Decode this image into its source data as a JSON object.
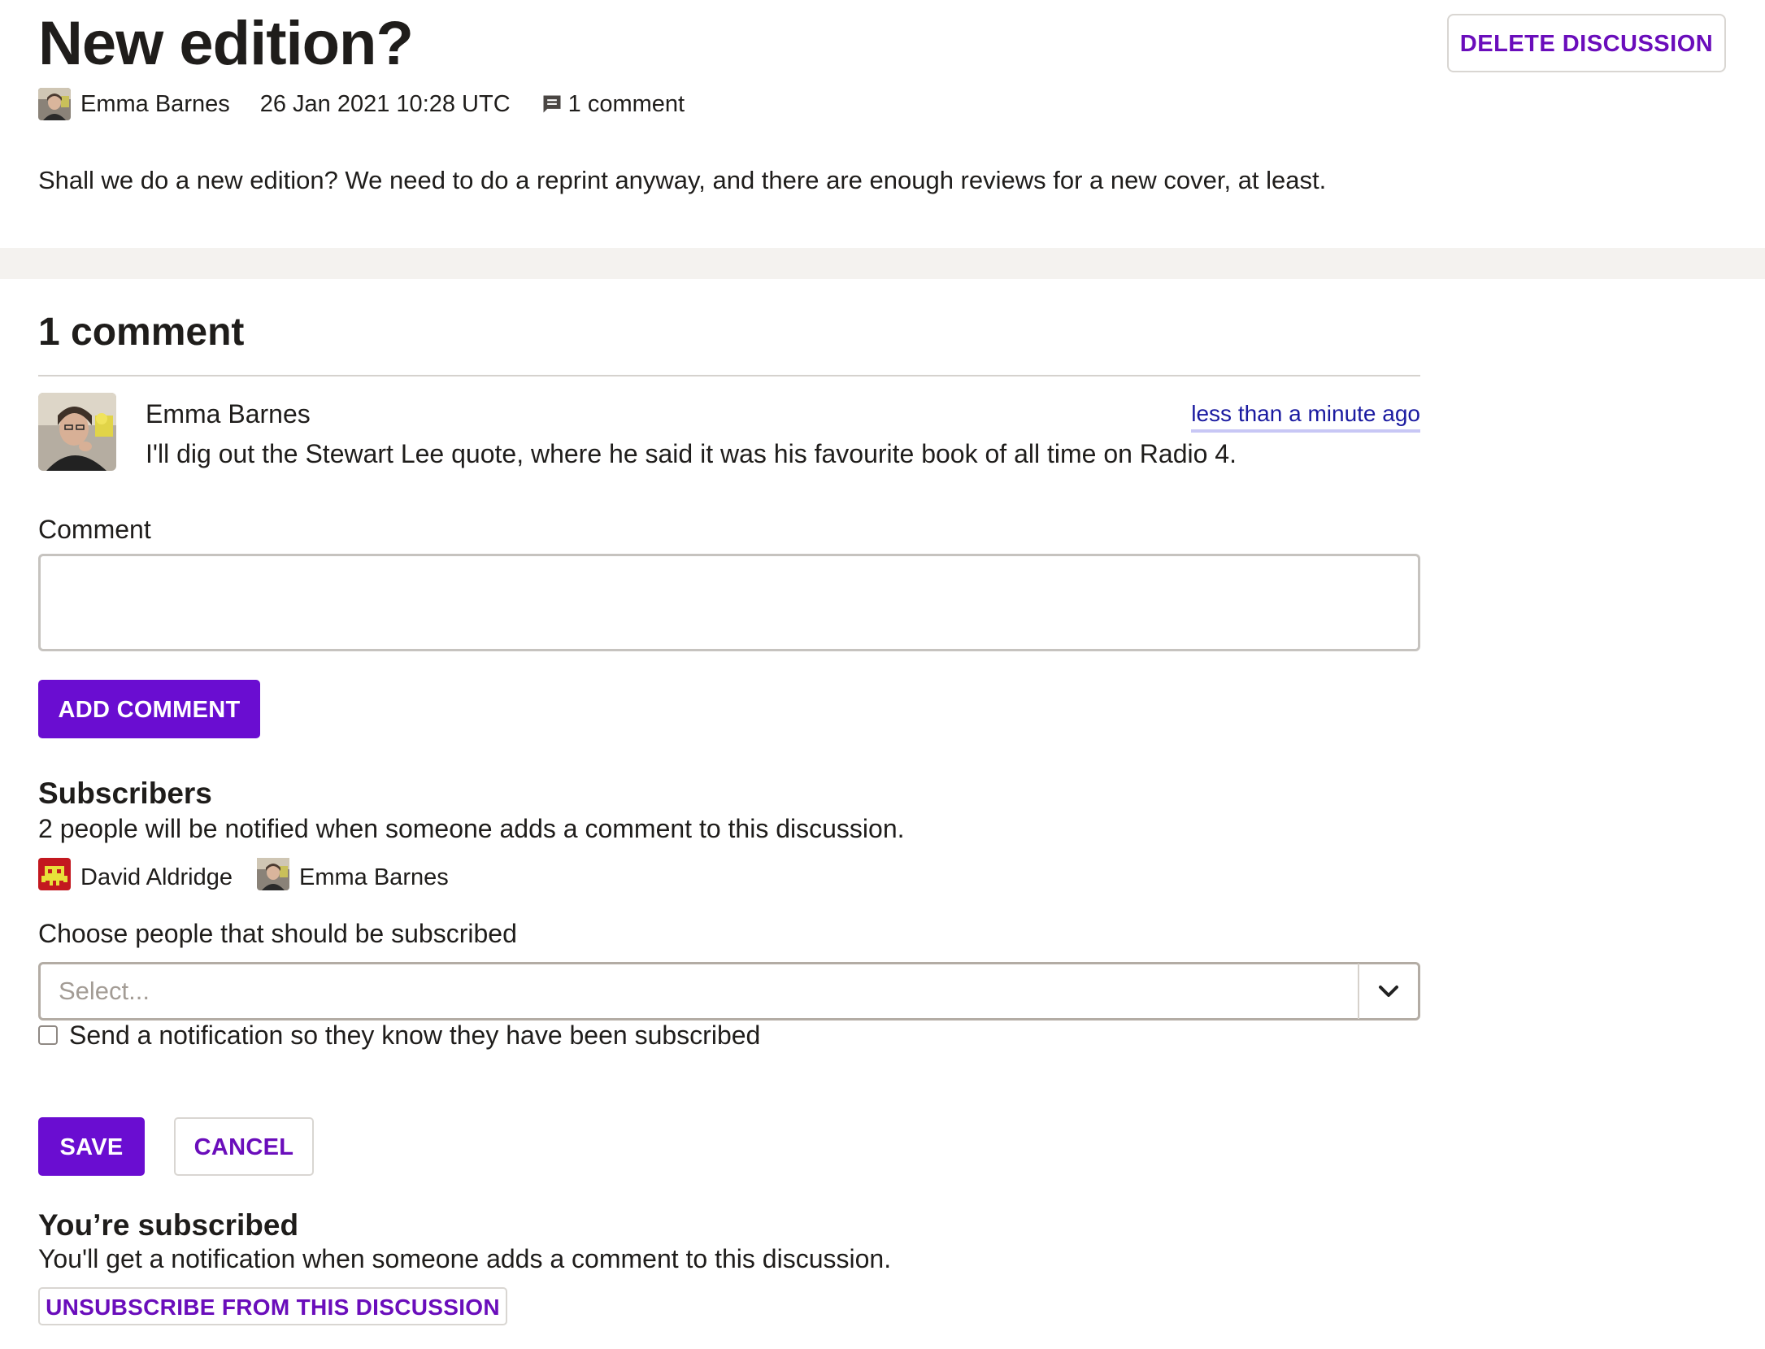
{
  "discussion": {
    "title": "New edition?",
    "delete_label": "DELETE DISCUSSION",
    "author": "Emma Barnes",
    "date": "26 Jan 2021 10:28 UTC",
    "comment_count_label": "1 comment",
    "body": "Shall we do a new edition? We need to do a reprint anyway, and there are enough reviews for a new cover, at least."
  },
  "comments_section": {
    "title": "1 comment",
    "items": [
      {
        "author": "Emma Barnes",
        "time": "less than a minute ago",
        "text": "I'll dig out the Stewart Lee quote, where he said it was his favourite book of all time on Radio 4."
      }
    ],
    "input_label": "Comment",
    "input_value": "",
    "add_button": "ADD COMMENT"
  },
  "subscribers": {
    "title": "Subscribers",
    "description": "2 people will be notified when someone adds a comment to this discussion.",
    "people": [
      {
        "name": "David Aldridge",
        "icon": "robot-avatar"
      },
      {
        "name": "Emma Barnes",
        "icon": "photo-avatar"
      }
    ],
    "choose_label": "Choose people that should be subscribed",
    "select_placeholder": "Select...",
    "notify_label": "Send a notification so they know they have been subscribed",
    "notify_checked": false,
    "save_button": "SAVE",
    "cancel_button": "CANCEL"
  },
  "subscription": {
    "title": "You’re subscribed",
    "description": "You'll get a notification when someone adds a comment to this discussion.",
    "unsubscribe_button": "UNSUBSCRIBE FROM THIS DISCUSSION"
  },
  "colors": {
    "accent": "#6a0dd1",
    "link": "#1a1aa0",
    "band": "#f4f2ef"
  }
}
